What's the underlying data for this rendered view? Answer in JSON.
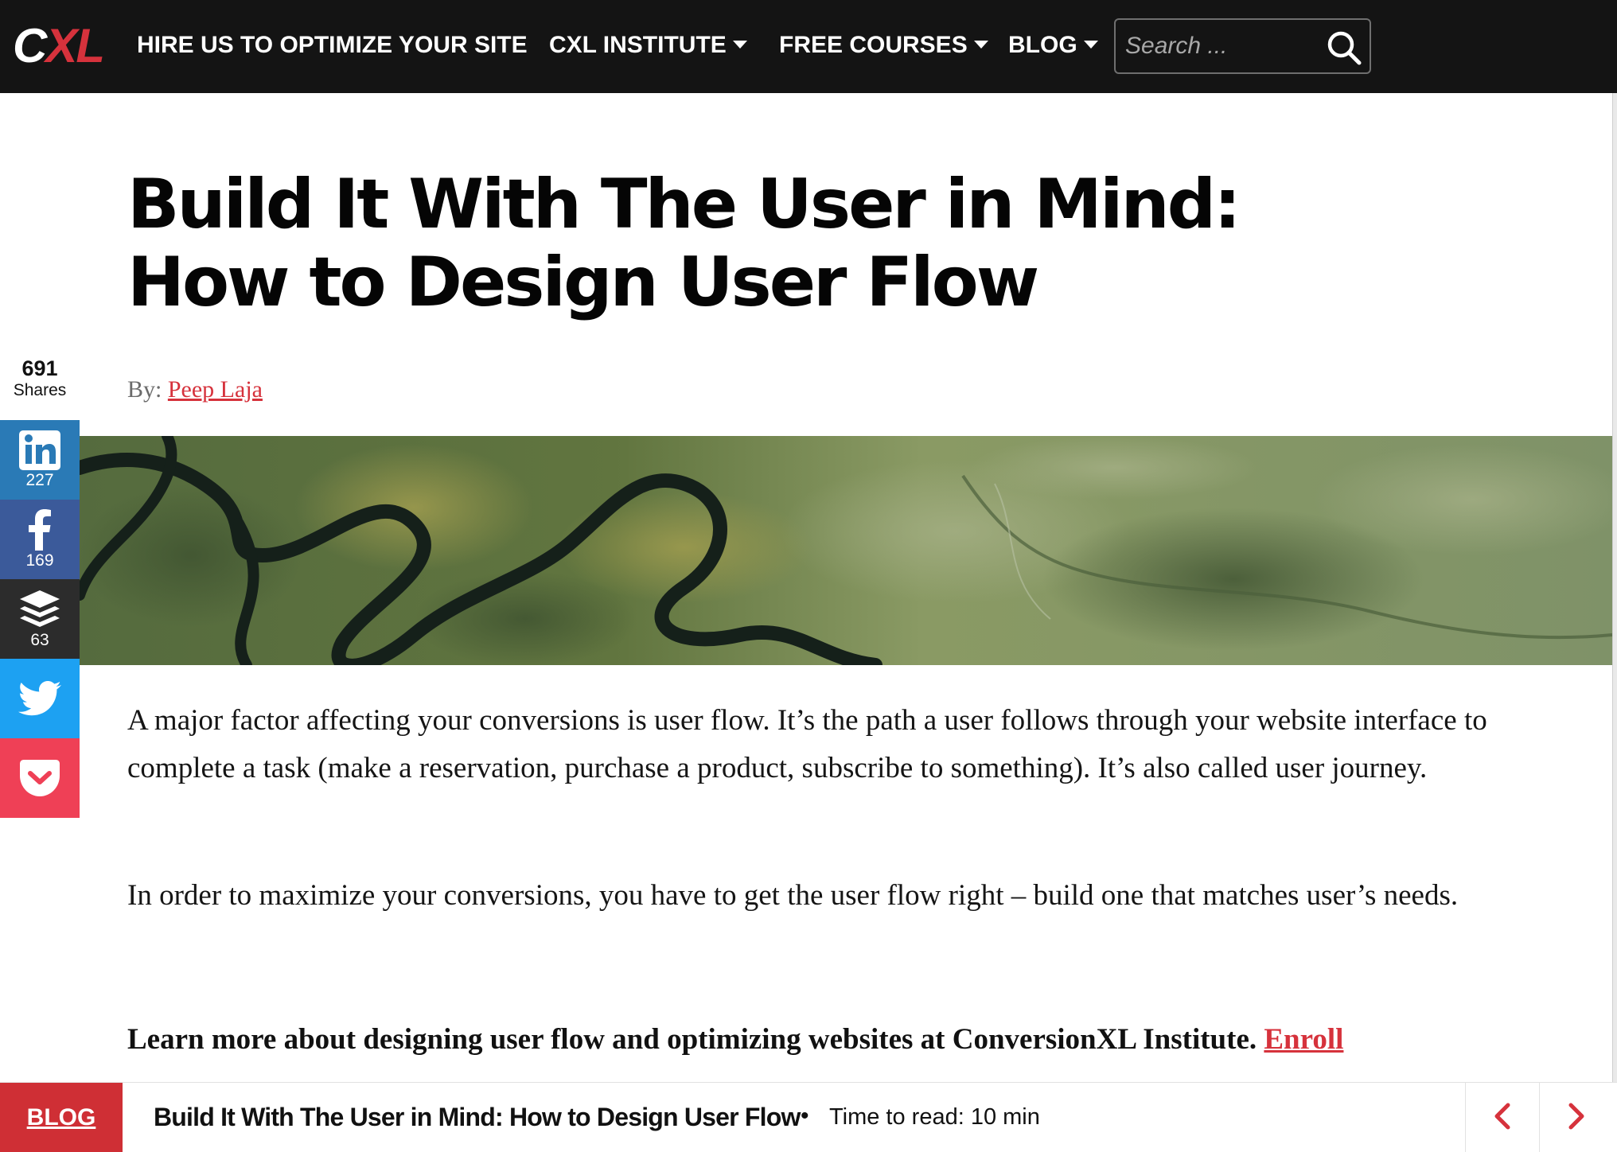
{
  "colors": {
    "brand_red": "#d6323c",
    "nav_bg": "#141414",
    "linkedin": "#2a7ab6",
    "facebook": "#3b5a9a",
    "buffer": "#2c2c2c",
    "twitter": "#1da1f2",
    "pocket": "#ef4056"
  },
  "header": {
    "logo_c": "C",
    "logo_xl": "XL",
    "nav": [
      {
        "label": "HIRE US TO OPTIMIZE YOUR SITE",
        "has_dropdown": false
      },
      {
        "label": "CXL INSTITUTE",
        "has_dropdown": true
      },
      {
        "label": "FREE COURSES",
        "has_dropdown": true
      },
      {
        "label": "BLOG",
        "has_dropdown": true
      }
    ],
    "search": {
      "placeholder": "Search ...",
      "icon": "search-icon"
    }
  },
  "article": {
    "title": "Build It With The User in Mind: How to Design User Flow",
    "byline_prefix": "By:",
    "author": "Peep Laja",
    "paragraphs": [
      "A major factor affecting your conversions is user flow. It’s the path a user follows through your website interface to complete a task (make a reservation, purchase a product, subscribe to something). It’s also called user journey.",
      "In order to maximize your conversions, you have to get the user flow right – build one that matches user’s needs."
    ],
    "cta_text": "Learn more about designing user flow and optimizing websites at ConversionXL Institute.",
    "cta_link": "Enroll"
  },
  "share": {
    "total": "691",
    "total_label": "Shares",
    "buttons": [
      {
        "network": "linkedin",
        "icon": "linkedin-icon",
        "count": "227"
      },
      {
        "network": "facebook",
        "icon": "facebook-icon",
        "count": "169"
      },
      {
        "network": "buffer",
        "icon": "buffer-icon",
        "count": "63"
      },
      {
        "network": "twitter",
        "icon": "twitter-icon",
        "count": ""
      },
      {
        "network": "pocket",
        "icon": "pocket-icon",
        "count": ""
      }
    ]
  },
  "bottom_bar": {
    "section": "BLOG",
    "title": "Build It With The User in Mind: How to Design User Flow",
    "separator": "•",
    "read_time": "Time to read: 10 min",
    "prev_icon": "chevron-left-icon",
    "next_icon": "chevron-right-icon"
  }
}
